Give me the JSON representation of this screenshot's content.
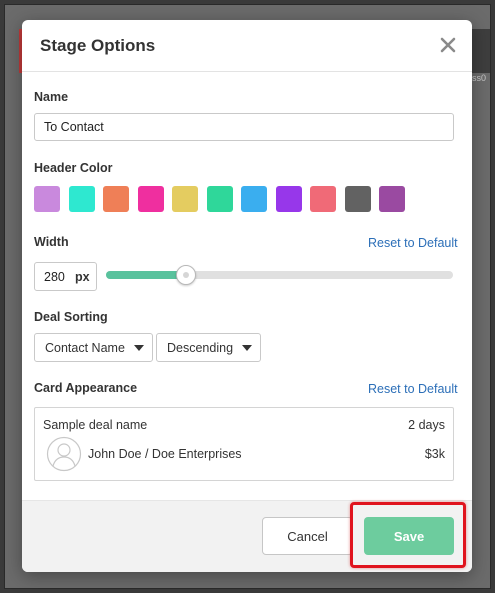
{
  "modal": {
    "title": "Stage Options",
    "close_icon": "close-icon"
  },
  "name": {
    "label": "Name",
    "value": "To Contact"
  },
  "header_color": {
    "label": "Header Color",
    "swatches": [
      "#c989dd",
      "#2ee8d0",
      "#ef7f57",
      "#ef2f9f",
      "#e4cc60",
      "#2fd79a",
      "#3aaeef",
      "#9737ea",
      "#f06a77",
      "#626262",
      "#9a4aa1"
    ]
  },
  "width": {
    "label": "Width",
    "reset_label": "Reset to Default",
    "value": "280",
    "unit": "px",
    "slider_fraction": 0.23
  },
  "deal_sorting": {
    "label": "Deal Sorting",
    "field": "Contact Name",
    "order": "Descending"
  },
  "card_appearance": {
    "label": "Card Appearance",
    "reset_label": "Reset to Default",
    "sample": {
      "deal_name": "Sample deal name",
      "days": "2 days",
      "contact": "John Doe / Doe Enterprises",
      "amount": "$3k",
      "avatar_icon": "user-avatar-icon"
    }
  },
  "footer": {
    "cancel_label": "Cancel",
    "save_label": "Save"
  },
  "background": {
    "partial_text": "ss0"
  }
}
